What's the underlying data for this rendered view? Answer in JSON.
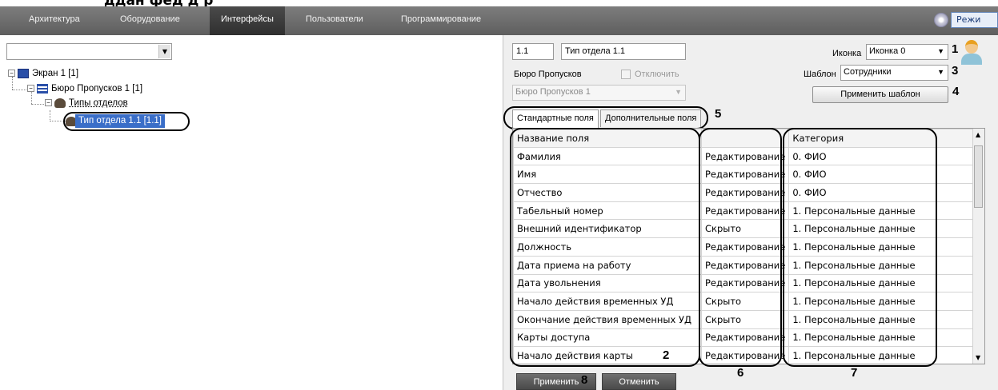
{
  "top_cut_text": "ддан    фед     д     р",
  "menu": {
    "items": [
      "Архитектура",
      "Оборудование",
      "Интерфейсы",
      "Пользователи",
      "Программирование"
    ],
    "active": "Интерфейсы",
    "mode_button": "Режи"
  },
  "tree": {
    "screen": "Экран 1 [1]",
    "bureau": "Бюро Пропусков 1 [1]",
    "types": "Типы отделов",
    "selected": "Тип отдела 1.1 [1.1]"
  },
  "form": {
    "id_value": "1.1",
    "name_value": "Тип отдела 1.1",
    "bureau_label": "Бюро Пропусков",
    "disable_label": "Отключить",
    "bureau_combo": "Бюро Пропусков 1",
    "icon_label": "Иконка",
    "icon_value": "Иконка 0",
    "template_label": "Шаблон",
    "template_value": "Сотрудники",
    "apply_template_button": "Применить шаблон"
  },
  "tabs": [
    "Стандартные поля",
    "Дополнительные поля"
  ],
  "table": {
    "headers": [
      "Название поля",
      "",
      "Категория"
    ],
    "rows": [
      [
        "Фамилия",
        "Редактирование",
        "0. ФИО"
      ],
      [
        "Имя",
        "Редактирование",
        "0. ФИО"
      ],
      [
        "Отчество",
        "Редактирование",
        "0. ФИО"
      ],
      [
        "Табельный номер",
        "Редактирование",
        "1. Персональные данные"
      ],
      [
        "Внешний идентификатор",
        "Скрыто",
        "1. Персональные данные"
      ],
      [
        "Должность",
        "Редактирование",
        "1. Персональные данные"
      ],
      [
        "Дата приема на работу",
        "Редактирование",
        "1. Персональные данные"
      ],
      [
        "Дата увольнения",
        "Редактирование",
        "1. Персональные данные"
      ],
      [
        "Начало действия временных УД",
        "Скрыто",
        "1. Персональные данные"
      ],
      [
        "Окончание действия временных УД",
        "Скрыто",
        "1. Персональные данные"
      ],
      [
        "Карты доступа",
        "Редактирование",
        "1. Персональные данные"
      ],
      [
        "Начало действия карты",
        "Редактирование",
        "1. Персональные данные"
      ]
    ]
  },
  "footer": {
    "apply_button": "Применить",
    "cancel_button": "Отменить"
  },
  "annotations": [
    "1",
    "2",
    "3",
    "4",
    "5",
    "6",
    "7",
    "8"
  ]
}
